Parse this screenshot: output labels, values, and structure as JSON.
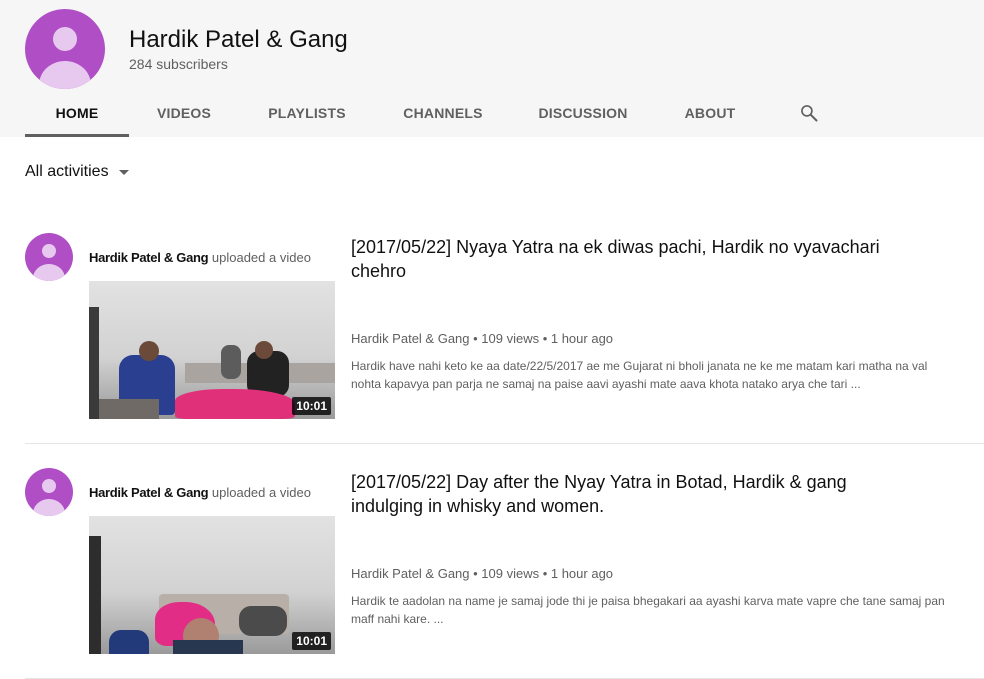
{
  "channel": {
    "name": "Hardik Patel & Gang",
    "subscribers": "284 subscribers"
  },
  "tabs": [
    {
      "label": "HOME",
      "active": true
    },
    {
      "label": "VIDEOS",
      "active": false
    },
    {
      "label": "PLAYLISTS",
      "active": false
    },
    {
      "label": "CHANNELS",
      "active": false
    },
    {
      "label": "DISCUSSION",
      "active": false
    },
    {
      "label": "ABOUT",
      "active": false
    }
  ],
  "icons": {
    "search": "search-icon",
    "dropdown": "caret-down-icon",
    "avatar": "avatar-icon"
  },
  "colors": {
    "avatar_bg": "#b04ec6",
    "header_bg": "#f6f6f6",
    "active_tab_underline": "#606060"
  },
  "filter": {
    "label": "All activities"
  },
  "activities": [
    {
      "author": "Hardik Patel & Gang",
      "action": " uploaded a video",
      "video": {
        "title": "[2017/05/22] Nyaya Yatra na ek diwas pachi, Hardik no vyavachari chehro",
        "meta": "Hardik Patel & Gang • 109 views • 1 hour ago",
        "description": "Hardik have nahi keto ke aa date/22/5/2017 ae me Gujarat ni bholi janata ne ke me matam kari matha na val nohta kapavya pan parja ne samaj na paise aavi ayashi mate aava khota natako arya che tari ...",
        "duration": "10:01"
      }
    },
    {
      "author": "Hardik Patel & Gang",
      "action": " uploaded a video",
      "video": {
        "title": "[2017/05/22] Day after the Nyay Yatra in Botad, Hardik & gang indulging in whisky and women.",
        "meta": "Hardik Patel & Gang • 109 views • 1 hour ago",
        "description": "Hardik te aadolan na name je samaj jode thi je paisa bhegakari aa ayashi karva mate vapre che tane samaj pan maff nahi kare. ...",
        "duration": "10:01"
      }
    }
  ]
}
